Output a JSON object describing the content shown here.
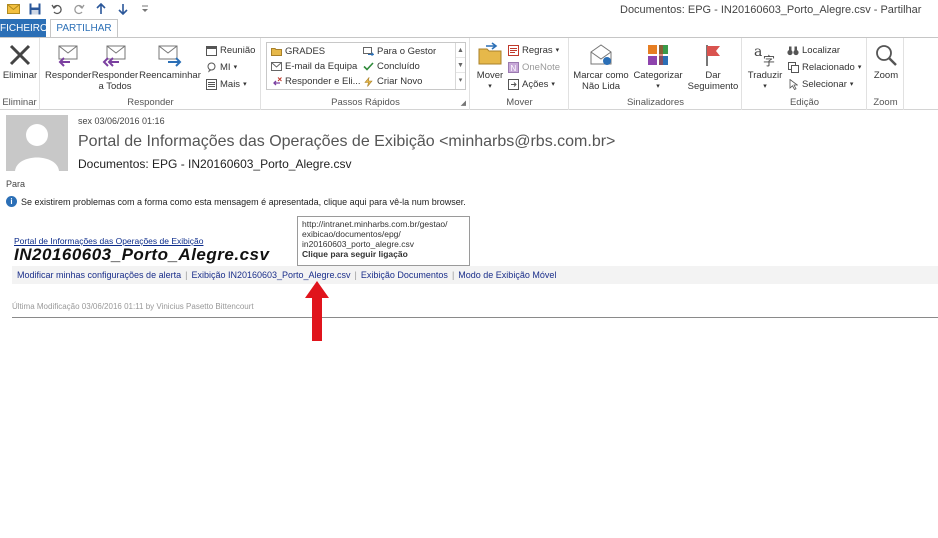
{
  "window": {
    "title": "Documentos: EPG - IN20160603_Porto_Alegre.csv - Partilhar"
  },
  "qat": {
    "items": [
      "mail-icon",
      "save-icon",
      "undo-icon",
      "redo-icon",
      "up-icon",
      "down-icon",
      "customize-icon"
    ]
  },
  "tabs": {
    "file": "FICHEIRO",
    "active": "PARTILHAR"
  },
  "ribbon": {
    "eliminar": {
      "button": "Eliminar",
      "group": "Eliminar"
    },
    "responder": {
      "group": "Responder",
      "reply": "Responder",
      "reply_all_1": "Responder",
      "reply_all_2": "a Todos",
      "forward": "Reencaminhar",
      "meeting": "Reunião",
      "im": "MI",
      "more": "Mais"
    },
    "passos": {
      "group": "Passos Rápidos",
      "items": [
        "GRADES",
        "Para o Gestor",
        "E-mail da Equipa",
        "Concluído",
        "Responder e Eli...",
        "Criar Novo"
      ]
    },
    "mover": {
      "group": "Mover",
      "move": "Mover",
      "rules": "Regras",
      "onenote": "OneNote",
      "actions": "Ações"
    },
    "sinalizadores": {
      "group": "Sinalizadores",
      "mark_1": "Marcar como",
      "mark_2": "Não Lida",
      "categorize": "Categorizar",
      "followup_1": "Dar",
      "followup_2": "Seguimento"
    },
    "edicao": {
      "group": "Edição",
      "translate": "Traduzir",
      "find": "Localizar",
      "related": "Relacionado",
      "select": "Selecionar"
    },
    "zoom": {
      "group": "Zoom",
      "button": "Zoom"
    }
  },
  "message": {
    "date": "sex 03/06/2016 01:16",
    "from": "Portal de Informações das Operações de Exibição <minharbs@rbs.com.br>",
    "subject": "Documentos: EPG - IN20160603_Porto_Alegre.csv",
    "to_label": "Para",
    "info": "Se existirem problemas com a forma como esta mensagem é apresentada, clique aqui para vê-la num browser."
  },
  "body": {
    "portal_link": "Portal de Informações das Operações de Exibição",
    "doc_title": "IN20160603_Porto_Alegre.csv",
    "links": [
      "Modificar minhas configurações de alerta",
      "Exibição IN20160603_Porto_Alegre.csv",
      "Exibição Documentos",
      "Modo de Exibição Móvel"
    ],
    "last_modified": "Última Modificação 03/06/2016 01:11 by Vinicius Pasetto Bittencourt"
  },
  "tooltip": {
    "line1": "http://intranet.minharbs.com.br/gestao/",
    "line2": "exibicao/documentos/epg/",
    "line3": "in20160603_porto_alegre.csv",
    "line4": "Clique para seguir ligação"
  },
  "colors": {
    "accent": "#2b6fb6",
    "arrow": "#e0141c"
  }
}
